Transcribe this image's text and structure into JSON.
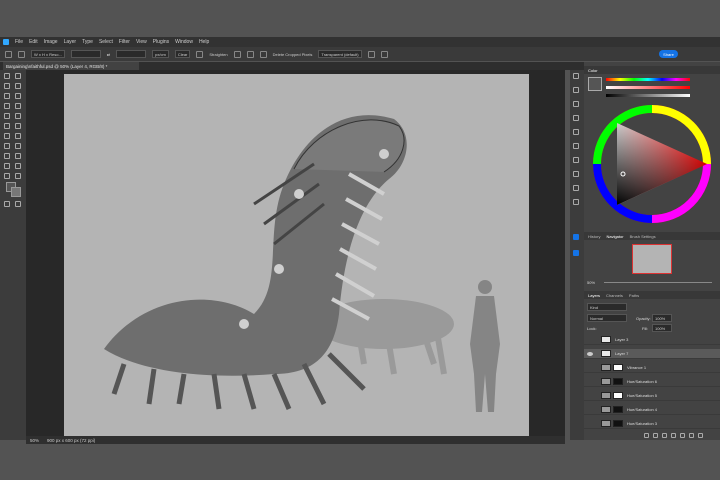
{
  "menubar": {
    "items": [
      "File",
      "Edit",
      "Image",
      "Layer",
      "Type",
      "Select",
      "Filter",
      "View",
      "Plugins",
      "Window",
      "Help"
    ]
  },
  "options": {
    "ratio": "W x H x Reso...",
    "units": "px/cm",
    "clear": "Clear",
    "straighten": "Straighten",
    "delete_cropped": "Delete Cropped Pixels",
    "fill": "Transparent (default)",
    "share": "Share"
  },
  "document": {
    "tab_title": "Bargaining\\nfaithful.psd @ 50% (Layer 4, RGB/8) *"
  },
  "status": {
    "zoom": "50%",
    "size": "900 px x 600 px (72 ppi)"
  },
  "color_panel": {
    "tab": "Color",
    "hue_color": "#ff0000"
  },
  "navigator": {
    "tabs": [
      "History",
      "Navigator",
      "Brush Settings"
    ],
    "zoom": "50%"
  },
  "layers": {
    "tabs": [
      "Layers",
      "Channels",
      "Paths"
    ],
    "kind": "Kind",
    "blend": "Normal",
    "opacity_label": "Opacity:",
    "opacity": "100%",
    "lock_label": "Lock:",
    "fill_label": "Fill:",
    "fill": "100%",
    "rows": [
      {
        "name": "Layer 3",
        "selected": false
      },
      {
        "name": "Layer 7",
        "selected": true
      },
      {
        "name": "Vibrance 1",
        "selected": false
      },
      {
        "name": "Hue/Saturation 6",
        "selected": false
      },
      {
        "name": "Hue/Saturation 5",
        "selected": false
      },
      {
        "name": "Hue/Saturation 4",
        "selected": false
      },
      {
        "name": "Hue/Saturation 3",
        "selected": false
      }
    ]
  }
}
